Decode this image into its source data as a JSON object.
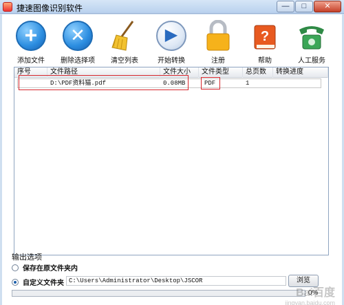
{
  "window": {
    "title": "捷速图像识别软件"
  },
  "toolbar": {
    "add_files": "添加文件",
    "delete_selected": "删除选择项",
    "clear_list": "清空列表",
    "start_convert": "开始转换",
    "register": "注册",
    "help": "帮助",
    "human_service": "人工服务"
  },
  "table": {
    "headers": [
      "序号",
      "文件路径",
      "文件大小",
      "文件类型",
      "总页数",
      "转换进度"
    ],
    "rows": [
      {
        "path": "D:\\PDF资料猫.pdf",
        "size": "0.08MB",
        "type": "PDF",
        "pages": "1",
        "progress": ""
      }
    ]
  },
  "output": {
    "section_label": "输出选项",
    "save_in_source": "保存在原文件夹内",
    "custom_folder": "自定义文件夹",
    "custom_path": "C:\\Users\\Administrator\\Desktop\\JSCOR",
    "browse_label": "浏览"
  },
  "progress": {
    "value": 0,
    "label": "0%"
  },
  "watermark": {
    "main": "Bai百度",
    "sub": "jingyan.baidu.com"
  },
  "colors": {
    "accent": "#2b8de0",
    "marker": "#d6242a"
  }
}
